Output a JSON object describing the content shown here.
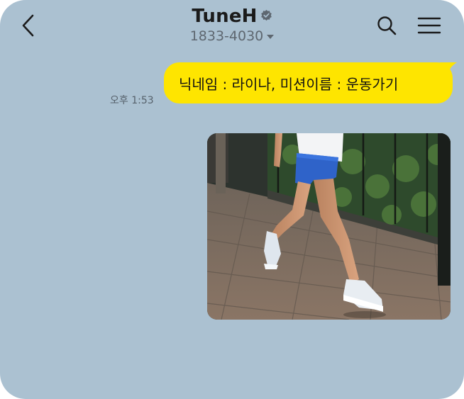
{
  "header": {
    "title": "TuneH",
    "phone": "1833-4030",
    "back_icon": "chevron-left-icon",
    "verified_icon": "verified-badge-icon",
    "search_icon": "search-icon",
    "menu_icon": "hamburger-menu-icon"
  },
  "messages": [
    {
      "type": "text",
      "direction": "outgoing",
      "text": "닉네임 : 라이나, 미션이름 : 운동가기",
      "time": "오후 1:53"
    },
    {
      "type": "image",
      "direction": "outgoing",
      "subject": "running-legs-photo"
    }
  ],
  "colors": {
    "chat_background": "#abc1d1",
    "outgoing_bubble": "#fee500"
  }
}
